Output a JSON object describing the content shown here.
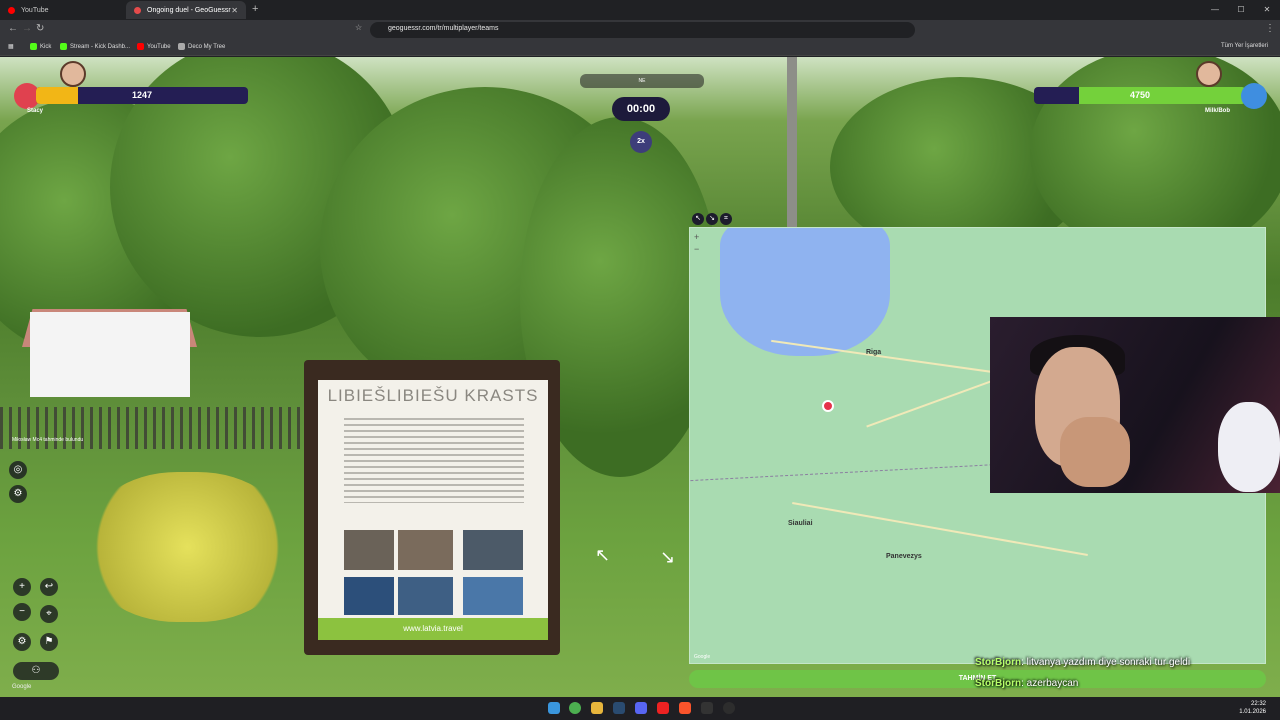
{
  "browser": {
    "tabs": [
      {
        "label": "YouTube",
        "color": "#ff0000"
      },
      {
        "label": "Ongoing duel - GeoGuessr",
        "color": "#e54b4b"
      }
    ],
    "url": "geoguessr.com/tr/multiplayer/teams",
    "bookmarks": [
      {
        "label": "Kick",
        "color": "#53fc18"
      },
      {
        "label": "Stream - Kick Dashb...",
        "color": "#53fc18"
      },
      {
        "label": "YouTube",
        "color": "#ff0000"
      },
      {
        "label": "Deco My Tree",
        "color": "#aaaaaa"
      }
    ],
    "bookmarks_right": "Tüm Yer İşaretleri"
  },
  "game": {
    "left_player": {
      "health": "1247",
      "name": "Stacy",
      "health_fraction": 0.2
    },
    "right_player": {
      "health": "4750",
      "name": "Milk/Bob",
      "health_fraction": 0.79
    },
    "timer": "00:00",
    "multiplier": "2x",
    "compass": "NE",
    "found_text": "Miłosław Mc4 tahminde bulundu",
    "guess_button": "TAHMİN ET",
    "google_label": "Google"
  },
  "sign": {
    "title": "LIBIEŠLIBIEŠU KRASTS",
    "footer": "www.latvia.travel"
  },
  "map": {
    "cities": [
      {
        "name": "Riga"
      },
      {
        "name": "Siauliai"
      },
      {
        "name": "Panevezys"
      }
    ],
    "attribution": "Google"
  },
  "chat": [
    {
      "user": "StorBjorn",
      "message": ": litvanya yazdım diye sonraki tur geldi"
    },
    {
      "user": "StorBjorn",
      "message": ": azerbaycan"
    }
  ],
  "taskbar": {
    "time": "22:32",
    "date": "1.01.2026"
  }
}
